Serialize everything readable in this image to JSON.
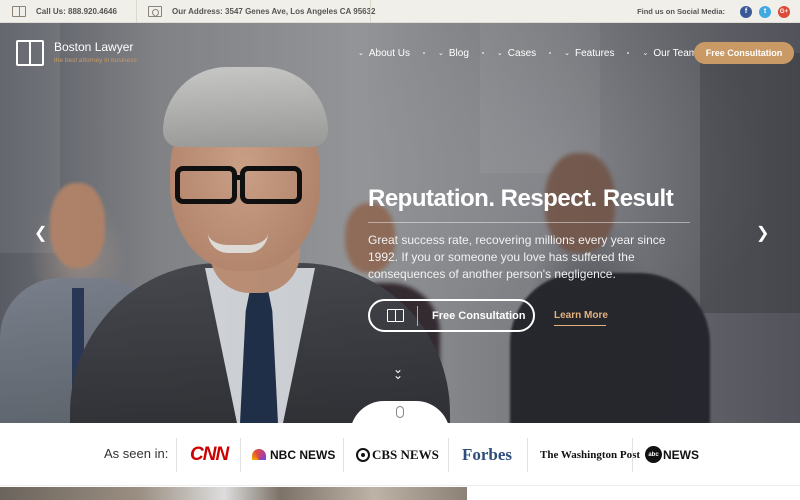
{
  "topbar": {
    "phone": "Call Us: 888.920.4646",
    "address": "Our Address: 3547 Genes Ave, Los Angeles CA 95632",
    "social_label": "Find us on Social Media:",
    "social": [
      {
        "name": "facebook",
        "glyph": "f"
      },
      {
        "name": "twitter",
        "glyph": "t"
      },
      {
        "name": "google-plus",
        "glyph": "G+"
      }
    ]
  },
  "logo": {
    "name": "Boston Lawyer",
    "tagline": "the best attorney in business"
  },
  "nav": {
    "items": [
      "About Us",
      "Blog",
      "Cases",
      "Features",
      "Our Team"
    ],
    "cta": "Free Consultation"
  },
  "hero": {
    "title": "Reputation. Respect. Result",
    "text": "Great success rate, recovering millions every year since 1992. If you or someone you love has suffered the consequences of another person's negligence.",
    "primary_button": "Free Consultation",
    "secondary_link": "Learn More"
  },
  "seen_in": {
    "label": "As seen in:",
    "brands": [
      "CNN",
      "NBC NEWS",
      "CBS NEWS",
      "Forbes",
      "The Washington Post",
      "NEWS"
    ]
  },
  "colors": {
    "accent": "#c99a66",
    "facebook": "#3b5998",
    "twitter": "#3fa9e0",
    "google": "#dd4b39"
  }
}
